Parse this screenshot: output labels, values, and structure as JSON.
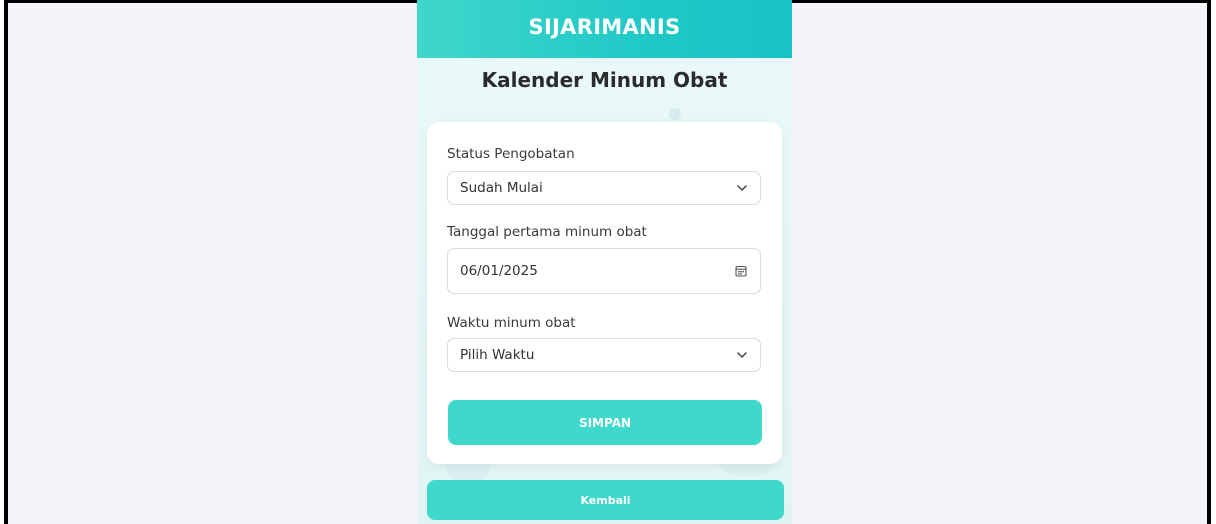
{
  "app": {
    "title": "SIJARIMANIS"
  },
  "page": {
    "title": "Kalender Minum Obat"
  },
  "form": {
    "status": {
      "label": "Status Pengobatan",
      "value": "Sudah Mulai",
      "icon": "chevron-down-icon"
    },
    "start_date": {
      "label": "Tanggal pertama minum obat",
      "value": "06/01/2025",
      "icon": "calendar-icon"
    },
    "time": {
      "label": "Waktu minum obat",
      "value": "Pilih Waktu",
      "icon": "chevron-down-icon"
    },
    "submit_label": "SIMPAN"
  },
  "footer": {
    "back_label": "Kembali"
  },
  "colors": {
    "header": "#20c9c7",
    "accent": "#3fd9cc",
    "background": "#f4f4f9"
  }
}
